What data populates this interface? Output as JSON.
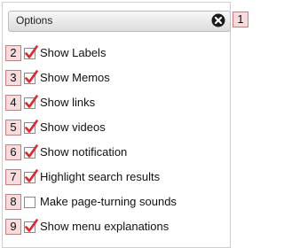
{
  "options": {
    "title": "Options",
    "close_icon": "close-icon",
    "title_badge": "1"
  },
  "items": [
    {
      "badge": "2",
      "label": "Show Labels",
      "checked": true
    },
    {
      "badge": "3",
      "label": "Show Memos",
      "checked": true
    },
    {
      "badge": "4",
      "label": "Show links",
      "checked": true
    },
    {
      "badge": "5",
      "label": "Show videos",
      "checked": true
    },
    {
      "badge": "6",
      "label": "Show notification",
      "checked": true
    },
    {
      "badge": "7",
      "label": "Highlight search results",
      "checked": true
    },
    {
      "badge": "8",
      "label": "Make page-turning sounds",
      "checked": false
    },
    {
      "badge": "9",
      "label": "Show menu explanations",
      "checked": true
    }
  ],
  "colors": {
    "check": "#e0262b",
    "badge_bg": "#f6dcdc",
    "badge_border": "#c97f7f"
  }
}
